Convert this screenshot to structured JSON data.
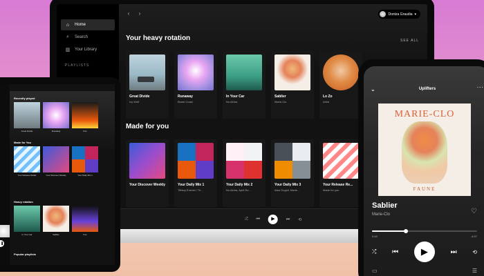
{
  "colors": {
    "accent": "#1db954",
    "background": "#121212"
  },
  "laptop": {
    "sidebar": {
      "items": [
        {
          "label": "Home",
          "icon": "home-icon"
        },
        {
          "label": "Search",
          "icon": "search-icon"
        },
        {
          "label": "Your Library",
          "icon": "library-icon"
        }
      ],
      "section_label": "PLAYLISTS"
    },
    "user_name": "Dontza Graudia",
    "heavy_rotation": {
      "title": "Your heavy rotation",
      "see_all": "SEE ALL",
      "cards": [
        {
          "title": "Great Divide",
          "sub": "Ivy Wolf"
        },
        {
          "title": "Runaway",
          "sub": "Beast Coast"
        },
        {
          "title": "In Your Car",
          "sub": "No Aloha"
        },
        {
          "title": "Sablier",
          "sub": "Marie-Clo"
        },
        {
          "title": "Lo Zo",
          "sub": "Artist"
        }
      ]
    },
    "made_for_you": {
      "title": "Made for you",
      "cards": [
        {
          "title": "Your Discover Weekly",
          "sub": ""
        },
        {
          "title": "Your Daily Mix 1",
          "sub": "Tiffany Eneveri, Th..."
        },
        {
          "title": "Your Daily Mix 2",
          "sub": "No Aloha, April Ro..."
        },
        {
          "title": "Your Daily Mix 3",
          "sub": "Alan Gogoll, Marie..."
        },
        {
          "title": "Your Release Re...",
          "sub": "Made for you"
        }
      ]
    }
  },
  "tablet": {
    "recently_played": "Recently played",
    "recent": [
      "Great Divide",
      "Runaway",
      "Fire"
    ],
    "made_for_you": "Made for You",
    "made": [
      "Your Release Radar",
      "Your Discover Weekly",
      "Your Daily Mix 1"
    ],
    "heavy_rotation": "Heavy rotation",
    "heavy": [
      "In Your Car",
      "Sablier",
      "Fire"
    ],
    "popular": "Popular playlists"
  },
  "phone": {
    "playlist": "Uplifters",
    "album_text_top": "MARIE-CLO",
    "album_text_bottom": "FAUNE",
    "track_title": "Sablier",
    "artist": "Marie-Clo",
    "time_elapsed": "0:43",
    "time_remaining": "-4:07",
    "progress": 0.32
  }
}
